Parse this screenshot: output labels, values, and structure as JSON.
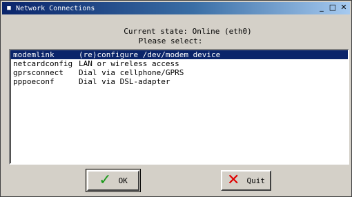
{
  "window": {
    "title": "Network Connections",
    "controls": {
      "minimize": "_",
      "maximize": "□",
      "close": "✕"
    }
  },
  "header": {
    "current_state": "Current state: Online (eth0)",
    "prompt": "Please select:"
  },
  "list": {
    "items": [
      {
        "command": "modemlink",
        "description": "(re)configure /dev/modem device",
        "selected": true
      },
      {
        "command": "netcardconfig",
        "description": "LAN or wireless access",
        "selected": false
      },
      {
        "command": "gprsconnect",
        "description": "Dial via cellphone/GPRS",
        "selected": false
      },
      {
        "command": "pppoeconf",
        "description": "Dial via DSL-adapter",
        "selected": false
      }
    ]
  },
  "buttons": {
    "ok": {
      "label": "OK",
      "icon": "check-icon",
      "color": "#1d9a1d"
    },
    "quit": {
      "label": "Quit",
      "icon": "x-icon",
      "color": "#e00000"
    }
  },
  "colors": {
    "selection": "#0a246a",
    "titlebar": "#0a246a",
    "face": "#d4d0c8"
  }
}
